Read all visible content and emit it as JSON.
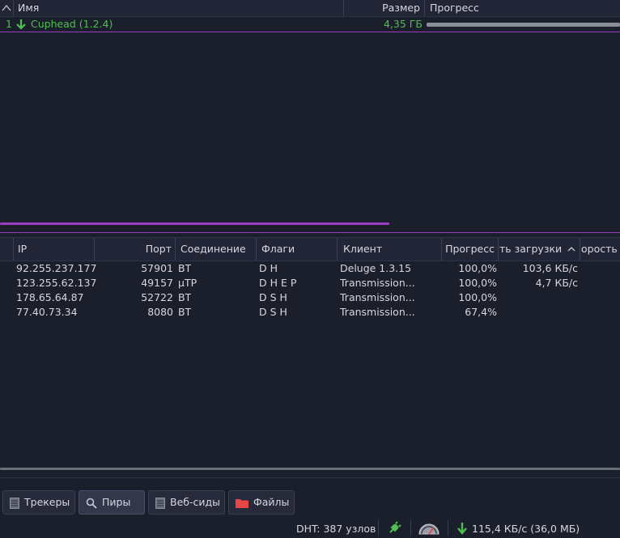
{
  "torrent_table": {
    "headers": {
      "name": "Имя",
      "size": "Размер",
      "progress": "Прогресс"
    },
    "rows": [
      {
        "index": "1",
        "name": "Cuphead (1.2.4)",
        "size": "4,35 ГБ",
        "progress": 1.0
      }
    ]
  },
  "peers_table": {
    "headers": {
      "ip": "IP",
      "port": "Порт",
      "connection": "Соединение",
      "flags": "Флаги",
      "client": "Клиент",
      "progress": "Прогресс",
      "download_speed": "ть загрузки",
      "upload_speed": "орость"
    },
    "rows": [
      {
        "ip": "92.255.237.177",
        "port": "57901",
        "connection": "BT",
        "flags": "D H",
        "client": "Deluge 1.3.15",
        "progress": "100,0%",
        "download_speed": "103,6 КБ/с"
      },
      {
        "ip": "123.255.62.137",
        "port": "49157",
        "connection": "µTP",
        "flags": "D H E P",
        "client": "Transmission...",
        "progress": "100,0%",
        "download_speed": "4,7 КБ/с"
      },
      {
        "ip": "178.65.64.87",
        "port": "52722",
        "connection": "BT",
        "flags": "D S H",
        "client": "Transmission...",
        "progress": "100,0%",
        "download_speed": ""
      },
      {
        "ip": "77.40.73.34",
        "port": "8080",
        "connection": "BT",
        "flags": "D S H",
        "client": "Transmission...",
        "progress": "67,4%",
        "download_speed": ""
      }
    ]
  },
  "tabs": {
    "trackers": "Трекеры",
    "peers": "Пиры",
    "webseeds": "Веб-сиды",
    "files": "Файлы"
  },
  "status": {
    "dht": "DHT: 387 узлов",
    "download": "115,4 КБ/с (36,0 МБ)"
  },
  "colors": {
    "accent": "#9b3dc0",
    "download_green": "#4fbf4f",
    "folder_red": "#e84545",
    "background": "#1b1e2b"
  },
  "icons": {
    "sort_up": "chevron-up-icon",
    "download": "arrow-down-icon",
    "trackers": "server-icon",
    "peers": "search-icon",
    "webseeds": "server-icon",
    "files": "folder-icon",
    "network": "plug-icon",
    "speed": "speedometer-icon"
  }
}
